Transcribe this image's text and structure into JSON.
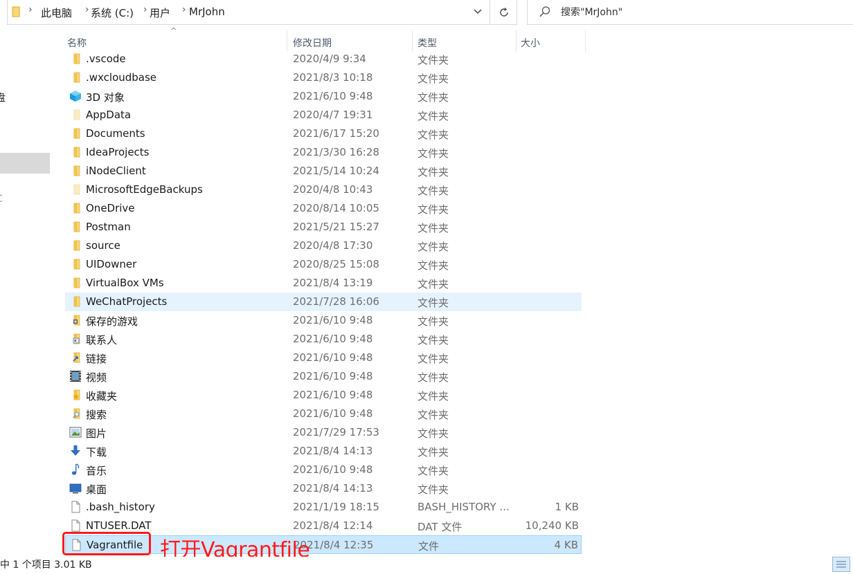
{
  "address": {
    "breadcrumbs": [
      "此电脑",
      "系统 (C:)",
      "用户",
      "MrJohn"
    ]
  },
  "search": {
    "placeholder": "搜索\"MrJohn\""
  },
  "nav_pane": {
    "chars": [
      "盘",
      "C"
    ]
  },
  "columns": {
    "name": "名称",
    "date": "修改日期",
    "type": "类型",
    "size": "大小"
  },
  "rows": [
    {
      "name": ".vscode",
      "date": "2020/4/9 9:34",
      "type": "文件夹",
      "size": "",
      "icon": "folder-icon"
    },
    {
      "name": ".wxcloudbase",
      "date": "2021/8/3 10:18",
      "type": "文件夹",
      "size": "",
      "icon": "folder-icon"
    },
    {
      "name": "3D 对象",
      "date": "2021/6/10 9:48",
      "type": "文件夹",
      "size": "",
      "icon": "3d-objects-icon"
    },
    {
      "name": "AppData",
      "date": "2020/4/7 19:31",
      "type": "文件夹",
      "size": "",
      "icon": "folder-hidden-icon"
    },
    {
      "name": "Documents",
      "date": "2021/6/17 15:20",
      "type": "文件夹",
      "size": "",
      "icon": "folder-icon"
    },
    {
      "name": "IdeaProjects",
      "date": "2021/3/30 16:28",
      "type": "文件夹",
      "size": "",
      "icon": "folder-icon"
    },
    {
      "name": "iNodeClient",
      "date": "2021/5/14 10:24",
      "type": "文件夹",
      "size": "",
      "icon": "folder-icon"
    },
    {
      "name": "MicrosoftEdgeBackups",
      "date": "2020/4/8 10:43",
      "type": "文件夹",
      "size": "",
      "icon": "folder-hidden-icon"
    },
    {
      "name": "OneDrive",
      "date": "2020/8/14 10:05",
      "type": "文件夹",
      "size": "",
      "icon": "folder-icon"
    },
    {
      "name": "Postman",
      "date": "2021/5/21 15:27",
      "type": "文件夹",
      "size": "",
      "icon": "folder-icon"
    },
    {
      "name": "source",
      "date": "2020/4/8 17:30",
      "type": "文件夹",
      "size": "",
      "icon": "folder-icon"
    },
    {
      "name": "UIDowner",
      "date": "2020/8/25 15:08",
      "type": "文件夹",
      "size": "",
      "icon": "folder-icon"
    },
    {
      "name": "VirtualBox VMs",
      "date": "2021/8/4 13:19",
      "type": "文件夹",
      "size": "",
      "icon": "folder-icon"
    },
    {
      "name": "WeChatProjects",
      "date": "2021/7/28 16:06",
      "type": "文件夹",
      "size": "",
      "icon": "folder-icon",
      "state": "hover"
    },
    {
      "name": "保存的游戏",
      "date": "2021/6/10 9:48",
      "type": "文件夹",
      "size": "",
      "icon": "saved-games-icon"
    },
    {
      "name": "联系人",
      "date": "2021/6/10 9:48",
      "type": "文件夹",
      "size": "",
      "icon": "contacts-icon"
    },
    {
      "name": "链接",
      "date": "2021/6/10 9:48",
      "type": "文件夹",
      "size": "",
      "icon": "links-icon"
    },
    {
      "name": "视频",
      "date": "2021/6/10 9:48",
      "type": "文件夹",
      "size": "",
      "icon": "videos-icon"
    },
    {
      "name": "收藏夹",
      "date": "2021/6/10 9:48",
      "type": "文件夹",
      "size": "",
      "icon": "favorites-icon"
    },
    {
      "name": "搜索",
      "date": "2021/6/10 9:48",
      "type": "文件夹",
      "size": "",
      "icon": "searches-icon"
    },
    {
      "name": "图片",
      "date": "2021/7/29 17:53",
      "type": "文件夹",
      "size": "",
      "icon": "pictures-icon"
    },
    {
      "name": "下载",
      "date": "2021/8/4 14:13",
      "type": "文件夹",
      "size": "",
      "icon": "downloads-icon"
    },
    {
      "name": "音乐",
      "date": "2021/6/10 9:48",
      "type": "文件夹",
      "size": "",
      "icon": "music-icon"
    },
    {
      "name": "桌面",
      "date": "2021/8/4 14:13",
      "type": "文件夹",
      "size": "",
      "icon": "desktop-icon"
    },
    {
      "name": ".bash_history",
      "date": "2021/1/19 18:15",
      "type": "BASH_HISTORY ...",
      "size": "1 KB",
      "icon": "file-icon"
    },
    {
      "name": "NTUSER.DAT",
      "date": "2021/8/4 12:14",
      "type": "DAT 文件",
      "size": "10,240 KB",
      "icon": "file-icon"
    },
    {
      "name": "Vagrantfile",
      "date": "2021/8/4 12:35",
      "type": "文件",
      "size": "4 KB",
      "icon": "file-icon",
      "state": "selected"
    }
  ],
  "annotation": {
    "text": "打开Vagrantfile",
    "color": "#ff1a1a"
  },
  "status_bar": {
    "text": "中 1 个项目  3.01 KB"
  },
  "colors": {
    "folder": "#f8d775",
    "hover": "#e5f3ff",
    "selected": "#cce8ff",
    "accent": "#0078d7"
  }
}
